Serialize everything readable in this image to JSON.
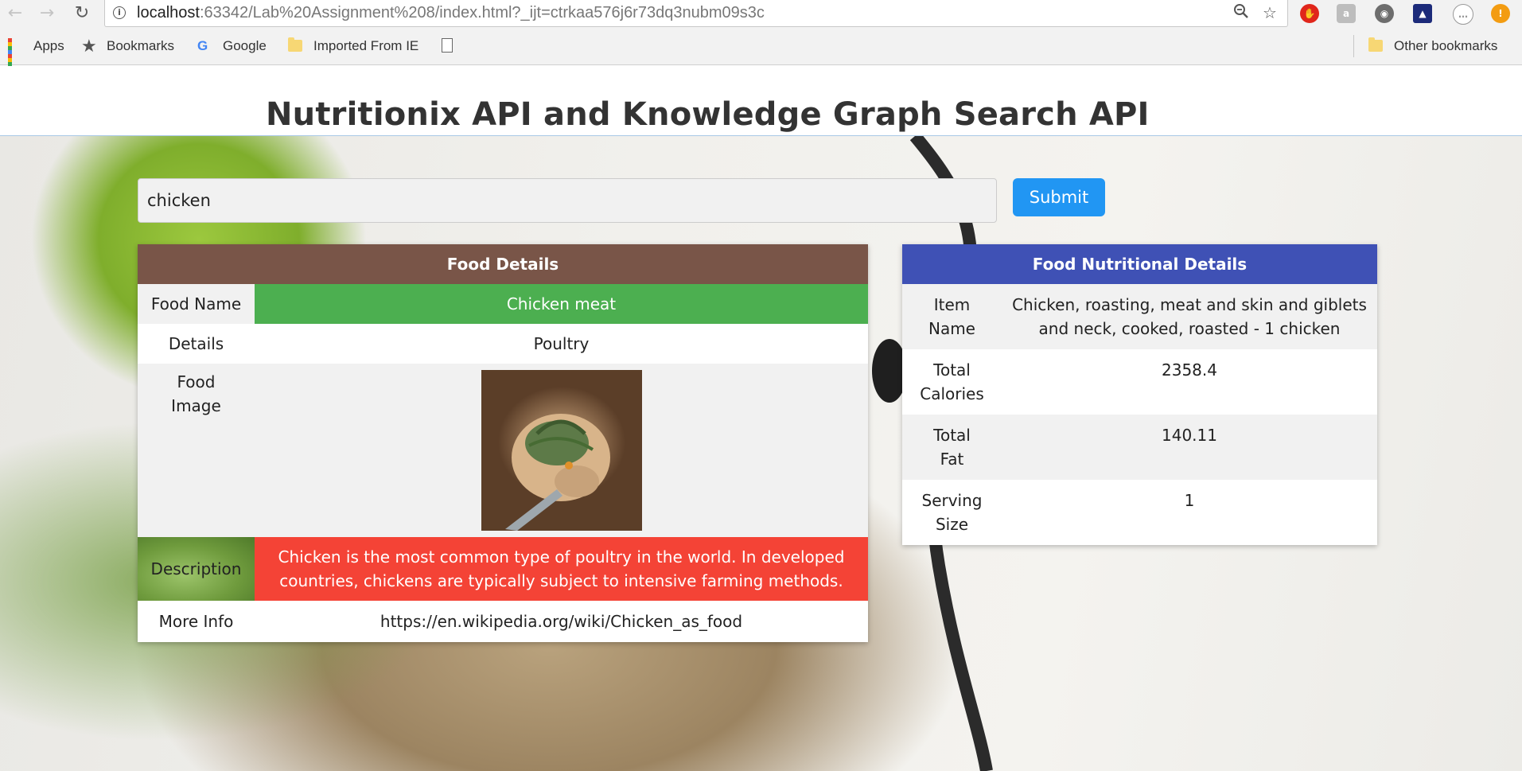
{
  "browser": {
    "url_host": "localhost",
    "url_rest": ":63342/Lab%20Assignment%208/index.html?_ijt=ctrkaa576j6r73dq3nubm09s3c",
    "bookmarks": [
      "Apps",
      "Bookmarks",
      "Google",
      "Imported From IE"
    ],
    "other_bookmarks": "Other bookmarks"
  },
  "page": {
    "title": "Nutritionix API and Knowledge Graph Search API",
    "search_value": "chicken",
    "submit_label": "Submit"
  },
  "food_details": {
    "header": "Food Details",
    "rows": {
      "name_label": "Food Name",
      "name_value": "Chicken meat",
      "details_label": "Details",
      "details_value": "Poultry",
      "image_label": "Food Image",
      "description_label": "Description",
      "description_value": "Chicken is the most common type of poultry in the world. In developed countries, chickens are typically subject to intensive farming methods.",
      "more_info_label": "More Info",
      "more_info_value": "https://en.wikipedia.org/wiki/Chicken_as_food"
    }
  },
  "nutrition": {
    "header": "Food Nutritional Details",
    "rows": [
      {
        "label": "Item Name",
        "value": "Chicken, roasting, meat and skin and giblets and neck, cooked, roasted - 1 chicken"
      },
      {
        "label": "Total Calories",
        "value": "2358.4"
      },
      {
        "label": "Total Fat",
        "value": "140.11"
      },
      {
        "label": "Serving Size",
        "value": "1"
      }
    ]
  },
  "colors": {
    "food_header": "#795548",
    "food_name_bg": "#4caf50",
    "description_bg": "#f44336",
    "nutrition_header": "#3f51b5",
    "submit": "#2196f3"
  }
}
